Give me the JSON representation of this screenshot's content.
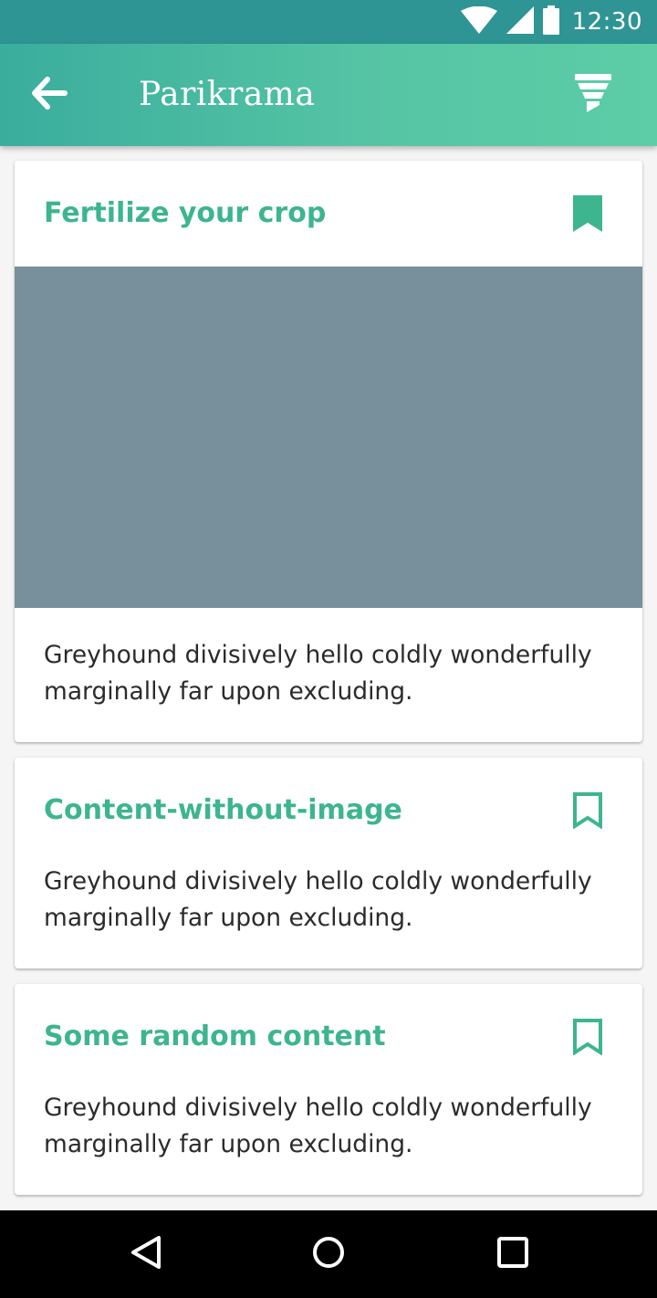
{
  "status_bar": {
    "time": "12:30",
    "icons": [
      "wifi-icon",
      "cellular-signal-icon",
      "battery-icon"
    ]
  },
  "app_bar": {
    "title": "Parikrama",
    "back_icon": "arrow-left-icon",
    "filter_icon": "filter-icon"
  },
  "cards": [
    {
      "title": "Fertilize your crop",
      "bookmarked": true,
      "has_image": true,
      "body": "Greyhound divisively hello coldly wonderfully marginally far upon excluding."
    },
    {
      "title": "Content-without-image",
      "bookmarked": false,
      "has_image": false,
      "body": "Greyhound divisively hello coldly wonderfully marginally far upon excluding."
    },
    {
      "title": "Some random content",
      "bookmarked": false,
      "has_image": false,
      "body": "Greyhound divisively hello coldly wonderfully marginally far upon excluding."
    }
  ],
  "nav_bar": {
    "buttons": [
      "back-triangle-icon",
      "home-circle-icon",
      "recents-square-icon"
    ]
  },
  "colors": {
    "status_bar": "#2f9594",
    "app_bar_start": "#3aad9d",
    "app_bar_end": "#5ccda6",
    "accent": "#3db58e",
    "image_placeholder": "#78909c",
    "body_text": "#2b2b2b"
  }
}
